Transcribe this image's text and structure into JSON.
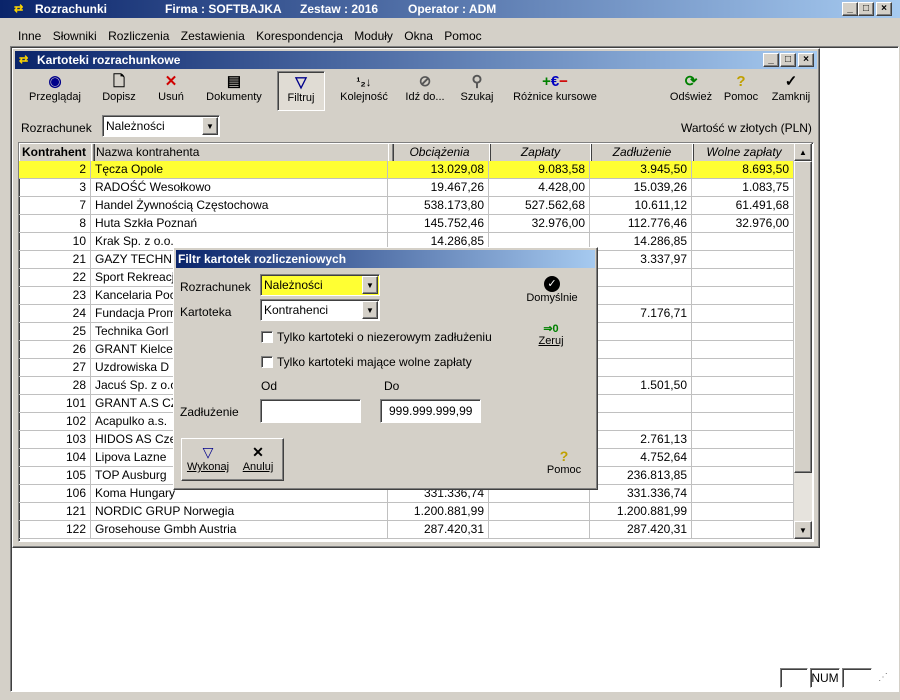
{
  "app": {
    "title": "Rozrachunki",
    "firma": "Firma : SOFTBAJKA",
    "zestaw": "Zestaw : 2016",
    "operator": "Operator : ADM"
  },
  "menu": [
    "Inne",
    "Słowniki",
    "Rozliczenia",
    "Zestawienia",
    "Korespondencja",
    "Moduły",
    "Okna",
    "Pomoc"
  ],
  "child": {
    "title": "Kartoteki rozrachunkowe",
    "toolbar": [
      "Przeglądaj",
      "Dopisz",
      "Usuń",
      "Dokumenty",
      "Filtruj",
      "Kolejność",
      "Idź do...",
      "Szukaj",
      "Różnice kursowe",
      "Odśwież",
      "Pomoc",
      "Zamknij"
    ],
    "rozrachunek_label": "Rozrachunek",
    "rozrachunek_value": "Należności",
    "currency_note": "Wartość w złotych (PLN)",
    "columns": [
      "Kontrahent",
      "Nazwa kontrahenta",
      "Obciążenia",
      "Zapłaty",
      "Zadłużenie",
      "Wolne zapłaty"
    ],
    "rows": [
      {
        "id": "2",
        "name": "Tęcza Opole",
        "obc": "13.029,08",
        "zap": "9.083,58",
        "zad": "3.945,50",
        "wol": "8.693,50"
      },
      {
        "id": "3",
        "name": "RADOŚĆ  Wesołkowo",
        "obc": "19.467,26",
        "zap": "4.428,00",
        "zad": "15.039,26",
        "wol": "1.083,75"
      },
      {
        "id": "7",
        "name": "Handel Żywnością Częstochowa",
        "obc": "538.173,80",
        "zap": "527.562,68",
        "zad": "10.611,12",
        "wol": "61.491,68"
      },
      {
        "id": "8",
        "name": "Huta Szkła Poznań",
        "obc": "145.752,46",
        "zap": "32.976,00",
        "zad": "112.776,46",
        "wol": "32.976,00"
      },
      {
        "id": "10",
        "name": "Krak Sp. z o.o.",
        "obc": "14.286,85",
        "zap": "",
        "zad": "14.286,85",
        "wol": ""
      },
      {
        "id": "21",
        "name": "GAZY TECHNIC",
        "obc": "",
        "zap": "",
        "zad": "3.337,97",
        "wol": ""
      },
      {
        "id": "22",
        "name": "Sport Rekreacj",
        "obc": "",
        "zap": "",
        "zad": "",
        "wol": ""
      },
      {
        "id": "23",
        "name": "Kancelaria Poc",
        "obc": "",
        "zap": "",
        "zad": "",
        "wol": ""
      },
      {
        "id": "24",
        "name": "Fundacja Prom",
        "obc": "",
        "zap": "",
        "zad": "7.176,71",
        "wol": ""
      },
      {
        "id": "25",
        "name": "Technika  Gorl",
        "obc": "",
        "zap": "",
        "zad": "",
        "wol": ""
      },
      {
        "id": "26",
        "name": "GRANT Kielce",
        "obc": "",
        "zap": "",
        "zad": "",
        "wol": ""
      },
      {
        "id": "27",
        "name": "Uzdrowiska  D",
        "obc": "",
        "zap": "",
        "zad": "",
        "wol": ""
      },
      {
        "id": "28",
        "name": "Jacuś  Sp. z o.o",
        "obc": "",
        "zap": "",
        "zad": "1.501,50",
        "wol": ""
      },
      {
        "id": "101",
        "name": "GRANT A.S CZ",
        "obc": "",
        "zap": "",
        "zad": "",
        "wol": ""
      },
      {
        "id": "102",
        "name": "Acapulko  a.s.",
        "obc": "",
        "zap": "",
        "zad": "",
        "wol": ""
      },
      {
        "id": "103",
        "name": "HIDOS AS Cze",
        "obc": "",
        "zap": "",
        "zad": "2.761,13",
        "wol": ""
      },
      {
        "id": "104",
        "name": "Lipova Lazne",
        "obc": "",
        "zap": "",
        "zad": "4.752,64",
        "wol": ""
      },
      {
        "id": "105",
        "name": "TOP Ausburg",
        "obc": "",
        "zap": "",
        "zad": "236.813,85",
        "wol": ""
      },
      {
        "id": "106",
        "name": "Koma Hungary",
        "obc": "331.336,74",
        "zap": "",
        "zad": "331.336,74",
        "wol": ""
      },
      {
        "id": "121",
        "name": "NORDIC GRUP Norwegia",
        "obc": "1.200.881,99",
        "zap": "",
        "zad": "1.200.881,99",
        "wol": ""
      },
      {
        "id": "122",
        "name": "Grosehouse Gmbh Austria",
        "obc": "287.420,31",
        "zap": "",
        "zad": "287.420,31",
        "wol": ""
      }
    ]
  },
  "dialog": {
    "title": "Filtr kartotek rozliczeniowych",
    "rozrachunek_label": "Rozrachunek",
    "rozrachunek_value": "Należności",
    "kartoteka_label": "Kartoteka",
    "kartoteka_value": "Kontrahenci",
    "chk1": "Tylko kartoteki o niezerowym zadłużeniu",
    "chk2": "Tylko kartoteki mające wolne zapłaty",
    "od_label": "Od",
    "do_label": "Do",
    "zadluzenie_label": "Zadłużenie",
    "od_value": "",
    "do_value": "999.999.999,99",
    "domyslnie": "Domyślnie",
    "zeruj": "Zeruj",
    "wykonaj": "Wykonaj",
    "anuluj": "Anuluj",
    "pomoc": "Pomoc"
  },
  "status": {
    "num": "NUM"
  },
  "colors": {
    "highlight": "#ffff33",
    "title_start": "#0a246a",
    "title_end": "#a6caf0"
  }
}
